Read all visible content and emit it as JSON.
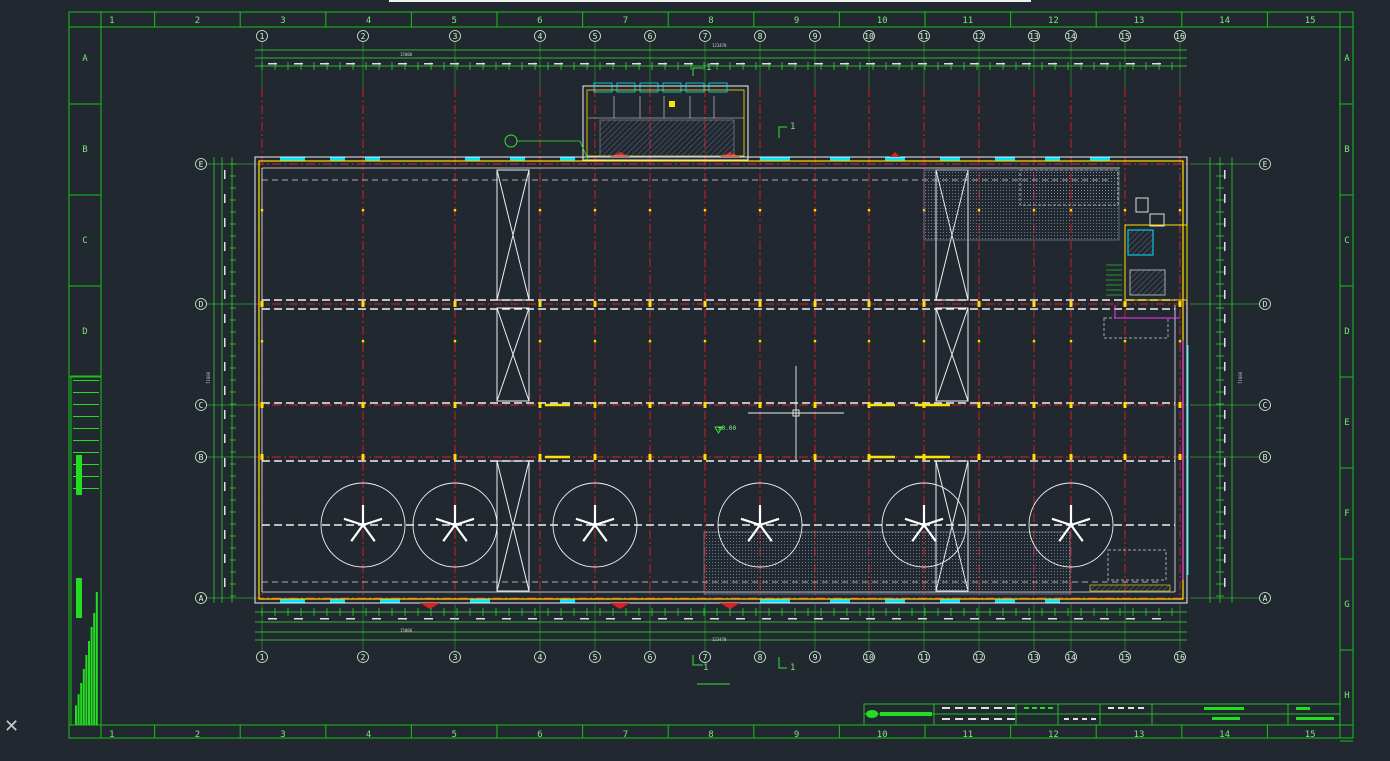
{
  "viewport": {
    "background_color": "#212830",
    "crosshair_cursor": "crosshair-cursor-icon",
    "ucs_icon": "ucs-axis-icon"
  },
  "colors": {
    "border": "#19c119",
    "axis_red": "#e02020",
    "wall": "#f0f0f0",
    "yellow": "#ffe100",
    "cyan": "#00e5ff",
    "magenta": "#ff33ff",
    "dim": "#2fe62f",
    "hatch": "#8899bb"
  },
  "frame": {
    "columns": [
      "1",
      "2",
      "3",
      "4",
      "5",
      "6",
      "7",
      "8",
      "9",
      "10",
      "11",
      "12",
      "13",
      "14",
      "15"
    ],
    "rows_left": [
      "A",
      "B",
      "C",
      "D"
    ],
    "rows_right": [
      "A",
      "B",
      "C",
      "D",
      "E",
      "F",
      "G",
      "H"
    ]
  },
  "grid": {
    "axes_top": [
      "1",
      "2",
      "3",
      "4",
      "5",
      "6",
      "7",
      "8",
      "9",
      "10",
      "11",
      "12",
      "13",
      "14",
      "15",
      "16"
    ],
    "axes_bottom": [
      "1",
      "2",
      "3",
      "4",
      "5",
      "6",
      "7",
      "8",
      "9",
      "10",
      "11",
      "12",
      "13",
      "14",
      "15",
      "16"
    ],
    "axes_left": [
      "E",
      "D",
      "C",
      "B",
      "A"
    ],
    "axes_right": [
      "E",
      "D",
      "C",
      "B",
      "A"
    ]
  },
  "annotations": {
    "section_top": "1",
    "section_top_mid": "1",
    "section_bottom_left": "1",
    "section_bottom_right": "1",
    "floor_elevation": "±0.00",
    "total_dim_top": "123470",
    "total_dim_bottom": "123470",
    "sub_dim_top": "15000",
    "sub_dim_bottom": "15000",
    "left_dim": "71000",
    "right_dim": "71000"
  }
}
